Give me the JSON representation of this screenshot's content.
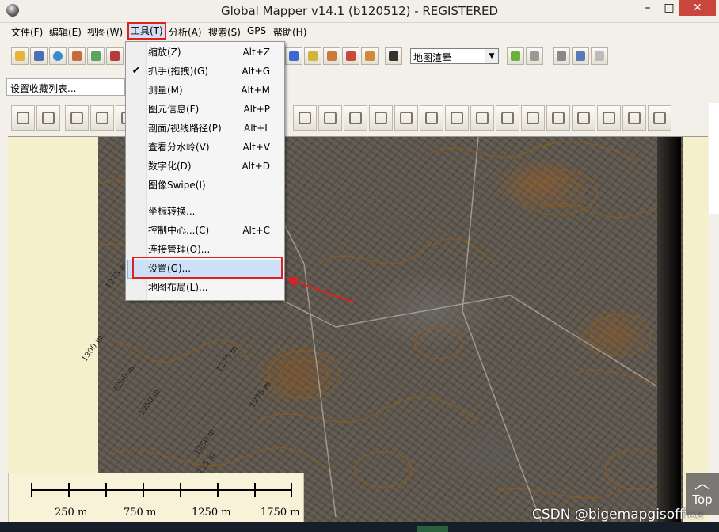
{
  "window": {
    "title": "Global Mapper v14.1 (b120512) - REGISTERED",
    "minimize_glyph": "–",
    "maximize_glyph": "□",
    "close_glyph": "✕"
  },
  "menubar": {
    "items": [
      {
        "label": "文件(F)"
      },
      {
        "label": "编辑(E)"
      },
      {
        "label": "视图(W)"
      },
      {
        "label": "工具(T)"
      },
      {
        "label": "分析(A)"
      },
      {
        "label": "搜索(S)"
      },
      {
        "label": "GPS"
      },
      {
        "label": "帮助(H)"
      }
    ]
  },
  "toolbar": {
    "render_mode_select": "地图渲晕"
  },
  "favorites": {
    "value": "设置收藏列表..."
  },
  "tools_menu": {
    "items": [
      {
        "label": "缩放(Z)",
        "shortcut": "Alt+Z"
      },
      {
        "label": "抓手(拖拽)(G)",
        "shortcut": "Alt+G",
        "checked": true
      },
      {
        "label": "测量(M)",
        "shortcut": "Alt+M"
      },
      {
        "label": "图元信息(F)",
        "shortcut": "Alt+P"
      },
      {
        "label": "剖面/视线路径(P)",
        "shortcut": "Alt+L"
      },
      {
        "label": "查看分水岭(V)",
        "shortcut": "Alt+V"
      },
      {
        "label": "数字化(D)",
        "shortcut": "Alt+D"
      },
      {
        "label": "图像Swipe(I)",
        "shortcut": ""
      },
      {
        "label": "坐标转换...",
        "shortcut": ""
      },
      {
        "label": "控制中心...(C)",
        "shortcut": "Alt+C"
      },
      {
        "label": "连接管理(O)...",
        "shortcut": ""
      },
      {
        "label": "设置(G)...",
        "shortcut": "",
        "highlighted": true
      },
      {
        "label": "地图布局(L)...",
        "shortcut": ""
      }
    ],
    "check_glyph": "✔"
  },
  "map": {
    "contour_labels": [
      "1275 m",
      "1300 m",
      "1250 m",
      "1275 m",
      "1250 m",
      "1275 m",
      "1250 m",
      "1225 m"
    ],
    "scale_labels": [
      "250 m",
      "750 m",
      "1250 m",
      "1750 m"
    ]
  },
  "overlay": {
    "watermark": "CSDN @bigemapgisoffice",
    "top_button_chevron": "︿",
    "top_button_label": "Top"
  },
  "colors": {
    "highlight_box": "#e02020",
    "menu_highlight": "#cce0f7",
    "close_button": "#c9463d",
    "contours": "#8a5a1e"
  }
}
